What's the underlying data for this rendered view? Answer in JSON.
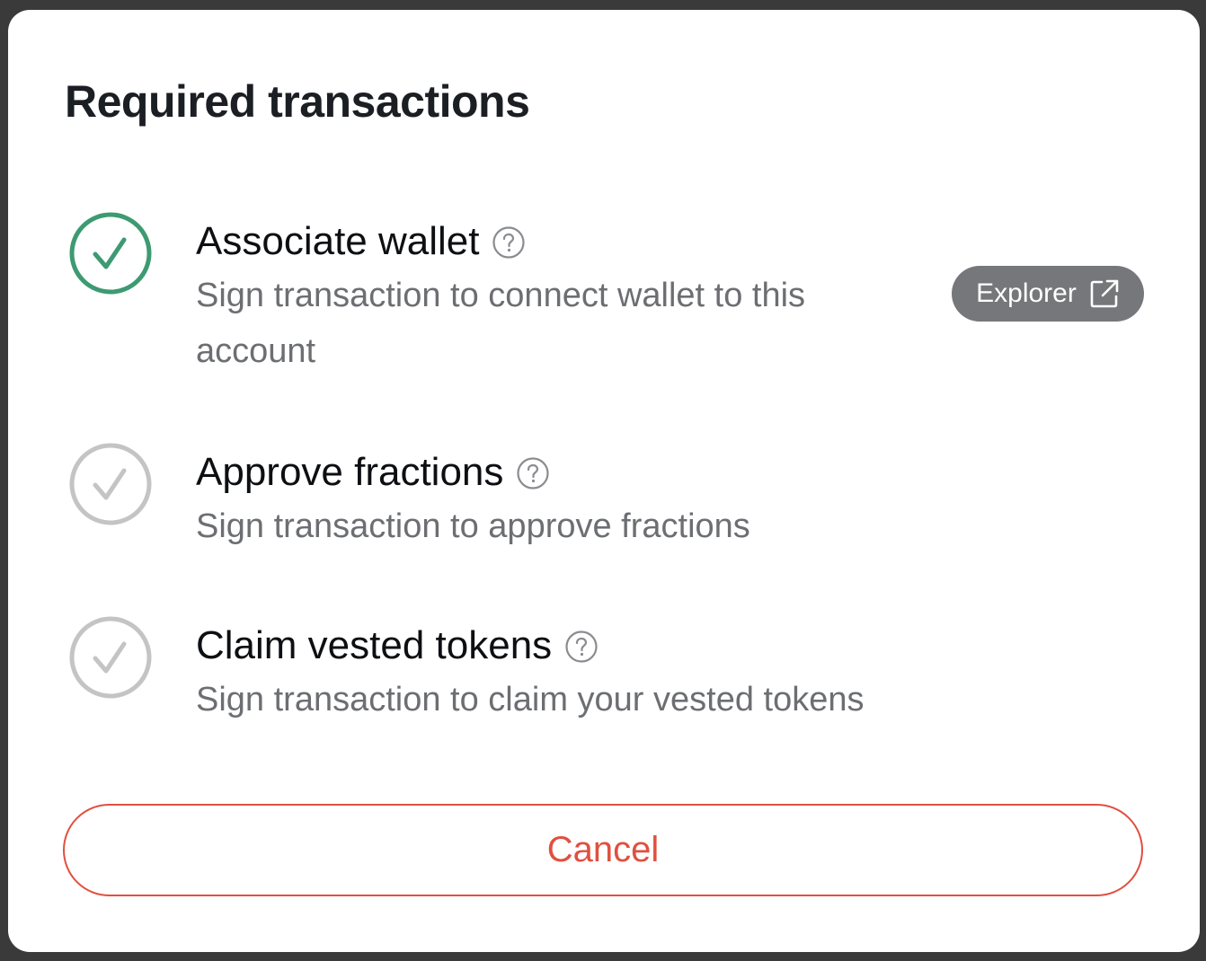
{
  "modal": {
    "title": "Required transactions"
  },
  "steps": [
    {
      "title": "Associate wallet",
      "description": "Sign transaction to connect wallet to this account",
      "status": "completed",
      "status_color": "#3d9a72"
    },
    {
      "title": "Approve fractions",
      "description": "Sign transaction to approve fractions",
      "status": "pending",
      "status_color": "#c4c4c4"
    },
    {
      "title": "Claim vested tokens",
      "description": "Sign transaction to claim your vested tokens",
      "status": "pending",
      "status_color": "#c4c4c4"
    }
  ],
  "explorer_button": {
    "label": "Explorer",
    "icon": "external-link-icon"
  },
  "cancel_button": {
    "label": "Cancel",
    "color": "#e0503f"
  },
  "icons": {
    "help": "question-circle-icon",
    "status": "check-circle-icon"
  }
}
